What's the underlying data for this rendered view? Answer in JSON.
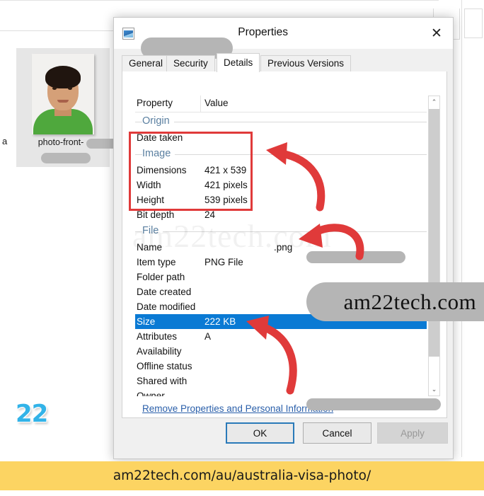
{
  "explorer": {
    "tile_label": "photo-front-",
    "left_letter": "a"
  },
  "watermark": {
    "logo": "22",
    "big_text": "am22tech.com",
    "brand_pill": "am22tech.com"
  },
  "dialog": {
    "title_suffix": " Properties",
    "icon": "image-file-icon",
    "close_label": "✕",
    "tabs": [
      {
        "label": "General",
        "active": false
      },
      {
        "label": "Security",
        "active": false
      },
      {
        "label": "Details",
        "active": true
      },
      {
        "label": "Previous Versions",
        "active": false
      }
    ],
    "columns": {
      "property": "Property",
      "value": "Value"
    },
    "groups": [
      {
        "section": "Origin",
        "rows": [
          {
            "key": "Date taken",
            "value": "",
            "selected": false
          }
        ]
      },
      {
        "section": "Image",
        "rows": [
          {
            "key": "Dimensions",
            "value": "421 x 539",
            "selected": false
          },
          {
            "key": "Width",
            "value": "421 pixels",
            "selected": false
          },
          {
            "key": "Height",
            "value": "539 pixels",
            "selected": false
          },
          {
            "key": "Bit depth",
            "value": "24",
            "selected": false
          }
        ]
      },
      {
        "section": "File",
        "rows": [
          {
            "key": "Name",
            "value": ".png",
            "selected": false
          },
          {
            "key": "Item type",
            "value": "PNG File",
            "selected": false
          },
          {
            "key": "Folder path",
            "value": "",
            "selected": false
          },
          {
            "key": "Date created",
            "value": "",
            "selected": false
          },
          {
            "key": "Date modified",
            "value": "",
            "selected": false
          },
          {
            "key": "Size",
            "value": "222 KB",
            "selected": true
          },
          {
            "key": "Attributes",
            "value": "A",
            "selected": false
          },
          {
            "key": "Availability",
            "value": "",
            "selected": false
          },
          {
            "key": "Offline status",
            "value": "",
            "selected": false
          },
          {
            "key": "Shared with",
            "value": "",
            "selected": false
          },
          {
            "key": "Owner",
            "value": "",
            "selected": false
          }
        ]
      }
    ],
    "remove_link": "Remove Properties and Personal Information",
    "buttons": {
      "ok": "OK",
      "cancel": "Cancel",
      "apply": "Apply"
    },
    "scrollbar": {
      "up": "⌃",
      "down": "⌄"
    }
  },
  "footer": {
    "url": "am22tech.com/au/australia-visa-photo/"
  },
  "colors": {
    "selection_blue": "#0a7ad4",
    "annotation_red": "#e03a3a",
    "footer_yellow": "#fcd462",
    "logo_blue": "#32b3e8",
    "link_blue": "#2a5faa",
    "section_blue": "#5a7fa0"
  }
}
